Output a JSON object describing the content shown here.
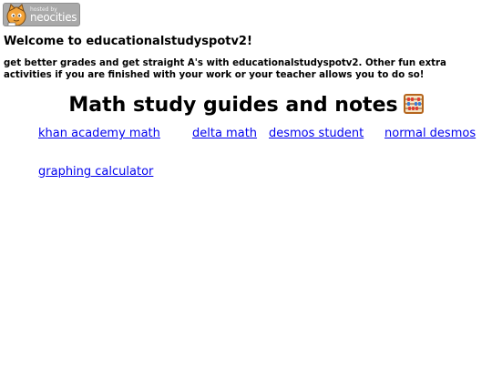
{
  "badge": {
    "small_text": "hosted by",
    "big_text": "neocities"
  },
  "welcome": "Welcome to educationalstudyspotv2!",
  "intro": "get better grades and get straight A's with educationalstudyspotv2. Other fun extra activities if you are finished with your work or your teacher allows you to do so!",
  "section": {
    "heading": "Math study guides and notes",
    "icon": "abacus-icon"
  },
  "links": [
    "khan academy math",
    "delta math",
    "desmos student",
    "normal desmos",
    "graphing calculator"
  ],
  "colors": {
    "link": "#0000ee",
    "badge_bg": "#a9a9a9"
  }
}
